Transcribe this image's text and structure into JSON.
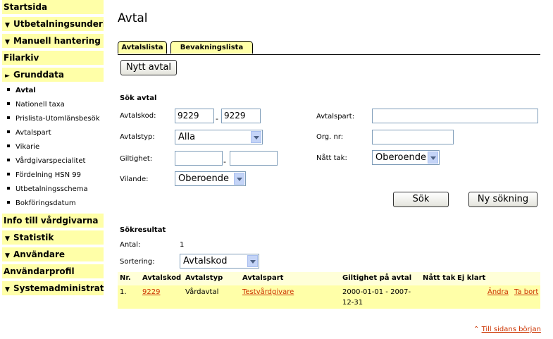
{
  "sidebar": {
    "top": [
      {
        "label": "Startsida"
      },
      {
        "label": "Utbetalningsunderlag"
      },
      {
        "label": "Manuell hantering"
      },
      {
        "label": "Filarkiv"
      },
      {
        "label": "Grunddata"
      }
    ],
    "grunddata_items": [
      {
        "label": "Avtal"
      },
      {
        "label": "Nationell taxa"
      },
      {
        "label": "Prislista-Utomlänsbesök"
      },
      {
        "label": "Avtalspart"
      },
      {
        "label": "Vikarie"
      },
      {
        "label": "Vårdgivarspecialitet"
      },
      {
        "label": "Fördelning HSN 99"
      },
      {
        "label": "Utbetalningsschema"
      },
      {
        "label": "Bokföringsdatum"
      }
    ],
    "bottom": [
      {
        "label": "Info till vårdgivarna"
      },
      {
        "label": "Statistik"
      },
      {
        "label": "Användare"
      },
      {
        "label": "Användarprofil"
      },
      {
        "label": "Systemadministration"
      }
    ]
  },
  "page": {
    "title": "Avtal"
  },
  "tabs": [
    {
      "label": "Avtalslista"
    },
    {
      "label": "Bevakningslista"
    }
  ],
  "buttons": {
    "new_contract": "Nytt avtal",
    "search": "Sök",
    "new_search": "Ny sökning"
  },
  "search": {
    "heading": "Sök avtal",
    "avtalskod_label": "Avtalskod:",
    "avtalskod_from": "9229",
    "avtalskod_to": "9229",
    "avtalstyp_label": "Avtalstyp:",
    "avtalstyp_value": "Alla",
    "giltighet_label": "Giltighet:",
    "giltighet_from": "",
    "giltighet_to": "",
    "vilande_label": "Vilande:",
    "vilande_value": "Oberoende",
    "avtalspart_label": "Avtalspart:",
    "avtalspart_value": "",
    "orgnr_label": "Org. nr:",
    "orgnr_value": "",
    "natt_tak_label": "Nått tak:",
    "natt_tak_value": "Oberoende",
    "dash": "-"
  },
  "results": {
    "heading": "Sökresultat",
    "antal_label": "Antal:",
    "antal_value": "1",
    "sort_label": "Sortering:",
    "sort_value": "Avtalskod",
    "columns": [
      "Nr.",
      "Avtalskod",
      "Avtalstyp",
      "Avtalspart",
      "Giltighet på avtal",
      "Nått tak",
      "Ej klart"
    ],
    "rows": [
      {
        "nr": "1.",
        "avtalskod": "9229",
        "avtalstyp": "Vårdavtal",
        "avtalspart": "Testvårdgivare",
        "giltighet_line1": "2000-01-01 - 2007-",
        "giltighet_line2": "12-31",
        "edit": "Ändra",
        "delete": "Ta bort"
      }
    ]
  },
  "footer": {
    "top_link": "Till sidans början"
  },
  "colors": {
    "sidebar_bg": "#ffffa8",
    "link": "#cc3300",
    "row_bg": "#ffffa8"
  },
  "icons": {
    "collapsed": "triangle-down",
    "expanded": "triangle-right",
    "bullet": "square-bullet",
    "up": "double-chevron-up"
  }
}
